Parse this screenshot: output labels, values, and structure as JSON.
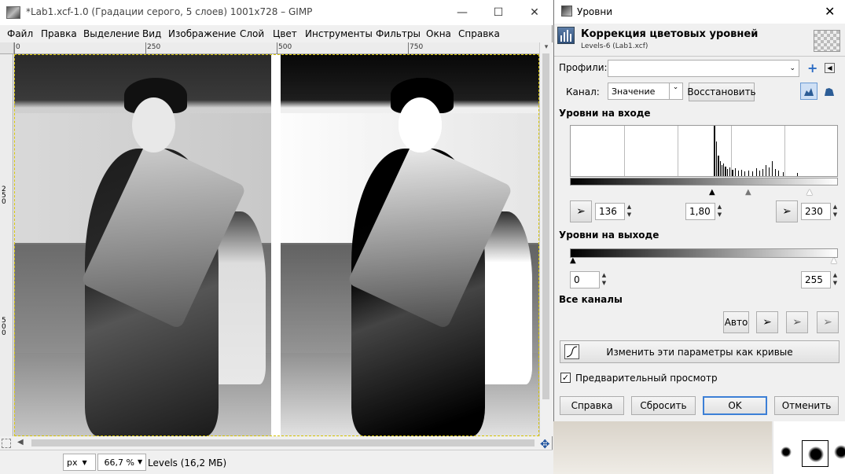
{
  "gimp": {
    "title": "*Lab1.xcf-1.0 (Градации серого, 5 слоев) 1001x728 – GIMP",
    "menu": [
      "Файл",
      "Правка",
      "Выделение",
      "Вид",
      "Изображение",
      "Слой",
      "Цвет",
      "Инструменты",
      "Фильтры",
      "Окна",
      "Справка"
    ],
    "ruler_h": [
      "0",
      "250",
      "500",
      "750"
    ],
    "ruler_v": [
      "250",
      "500"
    ],
    "status": {
      "unit": "px",
      "zoom": "66,7 %",
      "message": "Levels (16,2 МБ)"
    }
  },
  "levels": {
    "window_title": "Уровни",
    "heading": "Коррекция цветовых уровней",
    "subheading": "Levels-6 (Lab1.xcf)",
    "profiles_label": "Профили:",
    "profiles_value": "",
    "channel_label": "Канал:",
    "channel_value": "Значение",
    "reset_channel": "Восстановить",
    "input_levels": "Уровни на входе",
    "input_low": "136",
    "input_gamma": "1,80",
    "input_high": "230",
    "output_levels": "Уровни на выходе",
    "output_low": "0",
    "output_high": "255",
    "all_channels": "Все каналы",
    "auto": "Авто",
    "edit_curves": "Изменить эти параметры как кривые",
    "preview": "Предварительный просмотр",
    "preview_checked": true,
    "help": "Справка",
    "reset": "Сбросить",
    "ok": "OK",
    "cancel": "Отменить"
  }
}
